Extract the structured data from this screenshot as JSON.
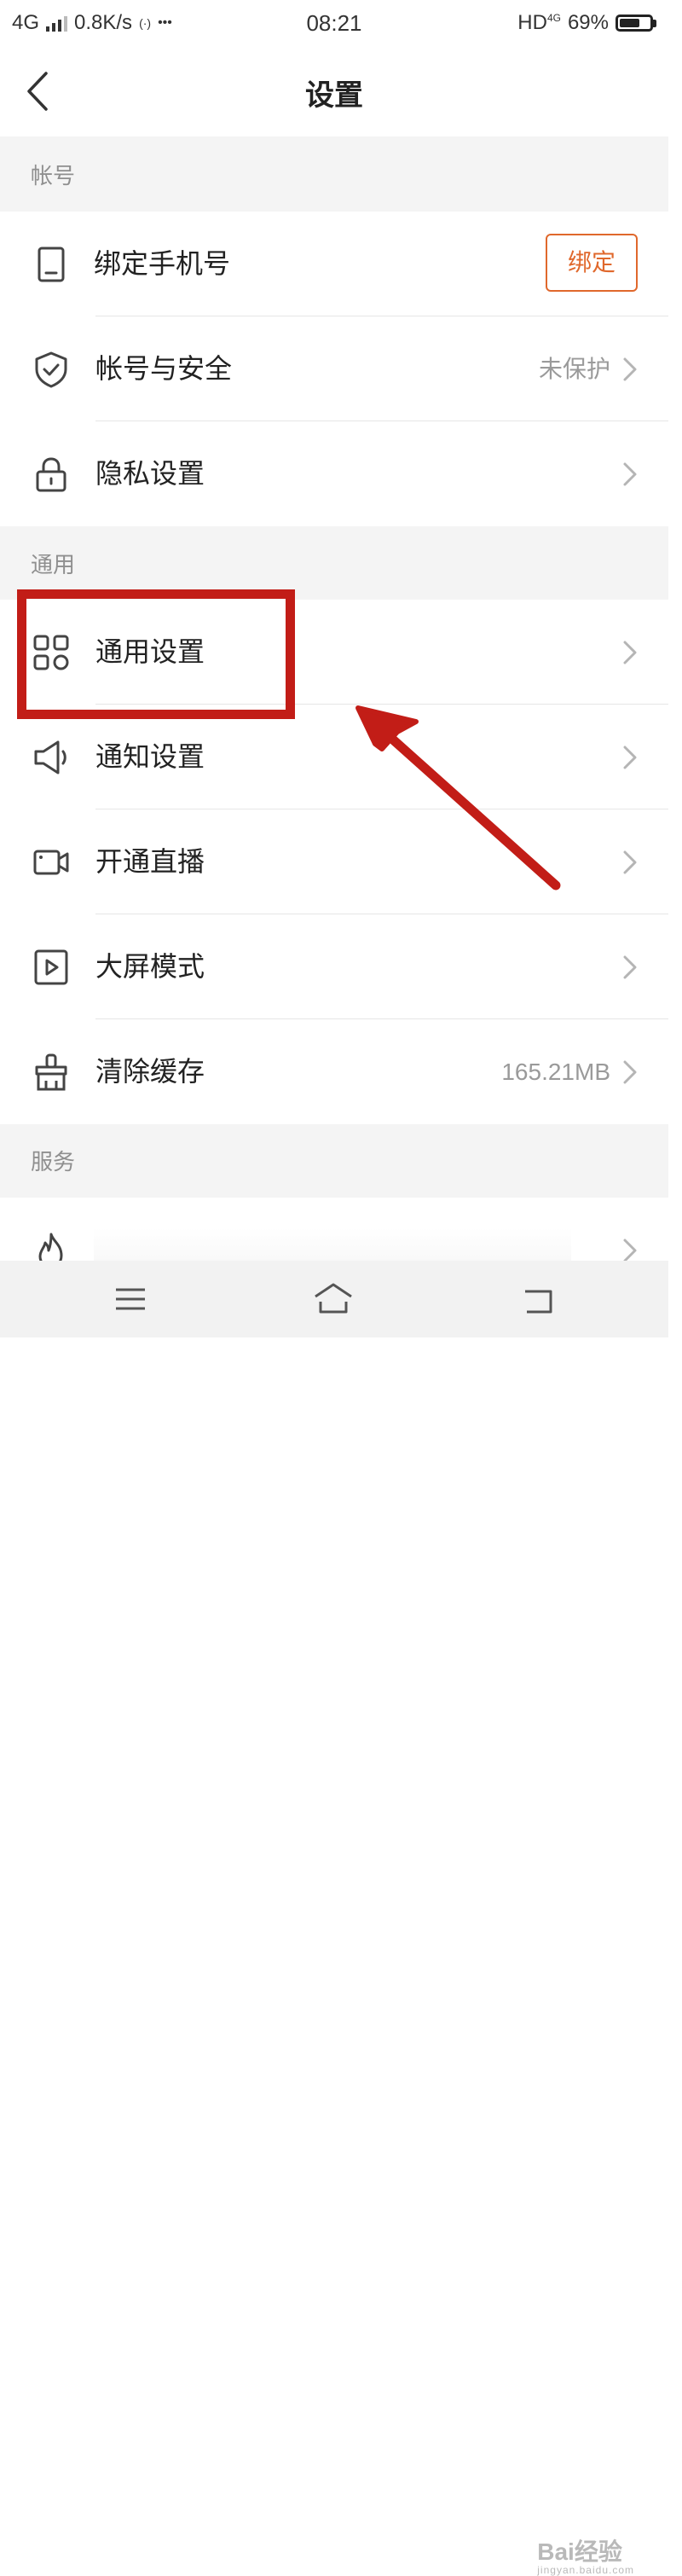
{
  "status_bar": {
    "network": "4G",
    "speed": "0.8K/s",
    "hotspot_symbol": "(·)",
    "more": "•••",
    "time": "08:21",
    "hd": "HD",
    "hd_net": "4G",
    "battery_percent": "69%",
    "battery_level": 0.69
  },
  "header": {
    "title": "设置",
    "back_icon": "chevron-left-icon"
  },
  "sections": {
    "account": "帐号",
    "general": "通用",
    "service": "服务"
  },
  "rows": {
    "bind_phone": {
      "label": "绑定手机号",
      "button": "绑定",
      "icon": "phone-icon"
    },
    "account_security": {
      "label": "帐号与安全",
      "value": "未保护",
      "icon": "shield-check-icon"
    },
    "privacy": {
      "label": "隐私设置",
      "icon": "lock-icon"
    },
    "general_settings": {
      "label": "通用设置",
      "icon": "grid-icon"
    },
    "notification": {
      "label": "通知设置",
      "icon": "speaker-icon"
    },
    "live": {
      "label": "开通直播",
      "icon": "video-camera-icon"
    },
    "big_screen": {
      "label": "大屏模式",
      "icon": "play-box-icon"
    },
    "clear_cache": {
      "label": "清除缓存",
      "value": "165.21MB",
      "icon": "brush-icon"
    },
    "hot": {
      "label": "",
      "icon": "flame-icon"
    }
  },
  "nav_bar": {
    "menu_icon": "menu-icon",
    "home_icon": "home-icon",
    "back_icon": "back-icon"
  },
  "watermark": {
    "brand": "Bai经验",
    "url": "jingyan.baidu.com"
  },
  "colors": {
    "accent": "#e0682c",
    "annotation": "#c21d17",
    "section_bg": "#f4f4f4",
    "muted_text": "#9a9a9a"
  }
}
